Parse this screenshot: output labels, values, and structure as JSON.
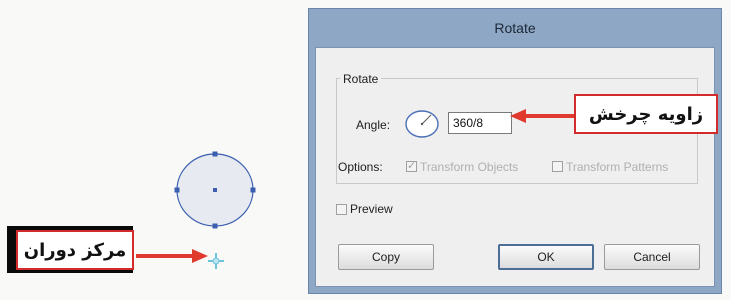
{
  "dialog": {
    "title": "Rotate",
    "group_label": "Rotate",
    "angle_label": "Angle:",
    "angle_value": "360/8",
    "options_label": "Options:",
    "transform_objects_label": "Transform Objects",
    "transform_objects_checked": true,
    "transform_patterns_label": "Transform Patterns",
    "transform_patterns_checked": false,
    "preview_label": "Preview",
    "preview_checked": false,
    "copy_label": "Copy",
    "ok_label": "OK",
    "cancel_label": "Cancel"
  },
  "callouts": {
    "rotation_angle": "زاویه چرخش",
    "rotation_center": "مرکز دوران"
  },
  "colors": {
    "dialog_frame": "#8ea7c4",
    "callout_border": "#d12b2b",
    "arrow": "#e03a2f",
    "shape_stroke": "#3a5fb0",
    "shape_fill": "#e7eaf1",
    "pivot": "#6fc3e0"
  }
}
